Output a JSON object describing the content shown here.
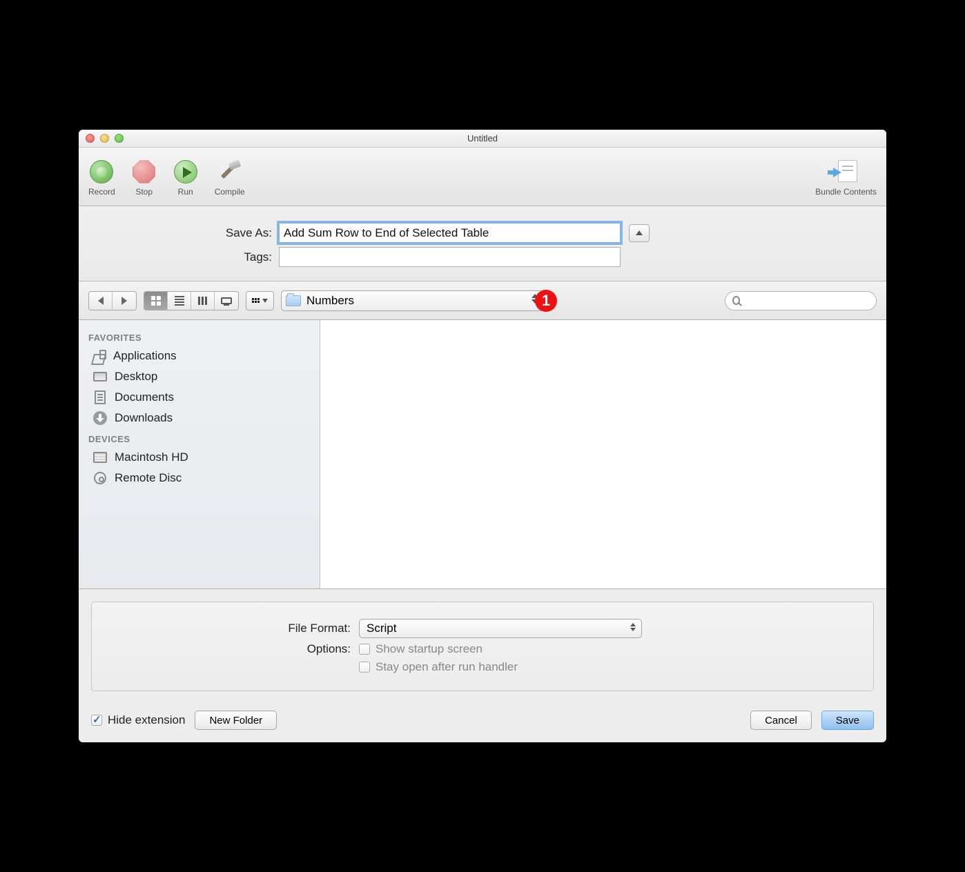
{
  "window": {
    "title": "Untitled"
  },
  "toolbar": {
    "record": "Record",
    "stop": "Stop",
    "run": "Run",
    "compile": "Compile",
    "bundle": "Bundle Contents"
  },
  "save_sheet": {
    "save_as_label": "Save As:",
    "save_as_value": "Add Sum Row to End of Selected Table",
    "tags_label": "Tags:",
    "tags_value": ""
  },
  "nav": {
    "location": "Numbers",
    "search_placeholder": ""
  },
  "annotation": {
    "badge1": "1"
  },
  "sidebar": {
    "favorites_header": "FAVORITES",
    "items": [
      {
        "label": "Applications"
      },
      {
        "label": "Desktop"
      },
      {
        "label": "Documents"
      },
      {
        "label": "Downloads"
      }
    ],
    "devices_header": "DEVICES",
    "devices": [
      {
        "label": "Macintosh HD"
      },
      {
        "label": "Remote Disc"
      }
    ]
  },
  "options": {
    "file_format_label": "File Format:",
    "file_format_value": "Script",
    "options_label": "Options:",
    "opt1": "Show startup screen",
    "opt2": "Stay open after run handler"
  },
  "bottom": {
    "hide_ext": "Hide extension",
    "new_folder": "New Folder",
    "cancel": "Cancel",
    "save": "Save"
  }
}
